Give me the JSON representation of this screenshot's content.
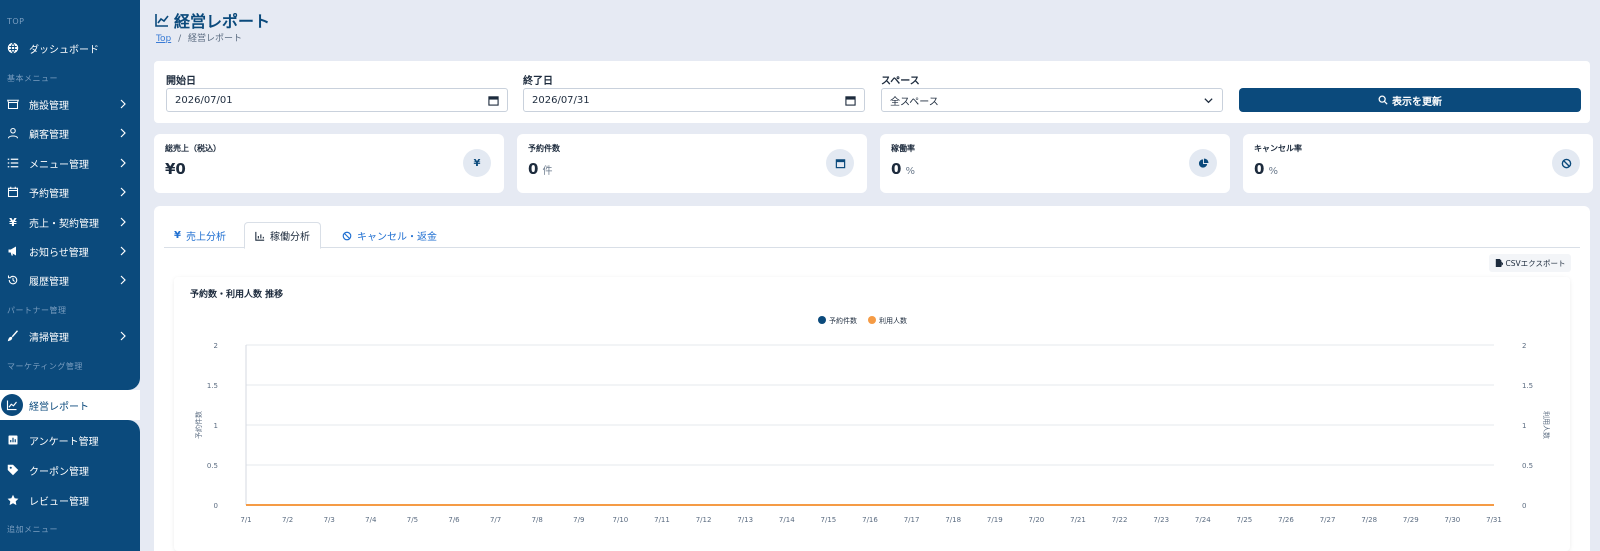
{
  "sidebar": {
    "sections": {
      "top": "TOP",
      "basic": "基本メニュー",
      "partner": "パートナー管理",
      "marketing": "マーケティング管理",
      "extra": "追加メニュー"
    },
    "items": {
      "dashboard": "ダッシュボード",
      "facility": "施設管理",
      "customer": "顧客管理",
      "menu": "メニュー管理",
      "reservation": "予約管理",
      "sales": "売上・契約管理",
      "news": "お知らせ管理",
      "history": "履歴管理",
      "cleaning": "清掃管理",
      "report": "経営レポート",
      "survey": "アンケート管理",
      "coupon": "クーポン管理",
      "review": "レビュー管理"
    },
    "accent_color": "#0b4a7c"
  },
  "header": {
    "title": "経営レポート",
    "breadcrumb_top": "Top",
    "breadcrumb_sep": "/",
    "breadcrumb_current": "経営レポート"
  },
  "filters": {
    "start_label": "開始日",
    "start_value": "2026/07/01",
    "end_label": "終了日",
    "end_value": "2026/07/31",
    "space_label": "スペース",
    "space_value": "全スペース",
    "refresh_label": "表示を更新"
  },
  "stats": [
    {
      "label": "総売上（税込）",
      "value": "¥0",
      "unit": "",
      "icon": "yen-icon"
    },
    {
      "label": "予約件数",
      "value": "0",
      "unit": "件",
      "icon": "calendar-icon"
    },
    {
      "label": "稼働率",
      "value": "0",
      "unit": "%",
      "icon": "pie-icon"
    },
    {
      "label": "キャンセル率",
      "value": "0",
      "unit": "%",
      "icon": "ban-icon"
    }
  ],
  "tabs": {
    "sales": "売上分析",
    "utilization": "稼働分析",
    "cancel": "キャンセル・返金"
  },
  "csv_label": "CSVエクスポート",
  "chart_data": {
    "type": "line",
    "title": "予約数・利用人数 推移",
    "x": [
      "7/1",
      "7/2",
      "7/3",
      "7/4",
      "7/5",
      "7/6",
      "7/7",
      "7/8",
      "7/9",
      "7/10",
      "7/11",
      "7/12",
      "7/13",
      "7/14",
      "7/15",
      "7/16",
      "7/17",
      "7/18",
      "7/19",
      "7/20",
      "7/21",
      "7/22",
      "7/23",
      "7/24",
      "7/25",
      "7/26",
      "7/27",
      "7/28",
      "7/29",
      "7/30",
      "7/31"
    ],
    "series": [
      {
        "name": "予約件数",
        "color": "#0b4a7c",
        "values": [
          0,
          0,
          0,
          0,
          0,
          0,
          0,
          0,
          0,
          0,
          0,
          0,
          0,
          0,
          0,
          0,
          0,
          0,
          0,
          0,
          0,
          0,
          0,
          0,
          0,
          0,
          0,
          0,
          0,
          0,
          0
        ]
      },
      {
        "name": "利用人数",
        "color": "#f59b45",
        "values": [
          0,
          0,
          0,
          0,
          0,
          0,
          0,
          0,
          0,
          0,
          0,
          0,
          0,
          0,
          0,
          0,
          0,
          0,
          0,
          0,
          0,
          0,
          0,
          0,
          0,
          0,
          0,
          0,
          0,
          0,
          0
        ]
      }
    ],
    "ylabel": "予約件数",
    "ylabel_right": "利用人数",
    "ylim": [
      0,
      2
    ],
    "yticks": [
      "0",
      "0.5",
      "1",
      "1.5",
      "2"
    ],
    "legend": "top-center",
    "grid": true
  }
}
